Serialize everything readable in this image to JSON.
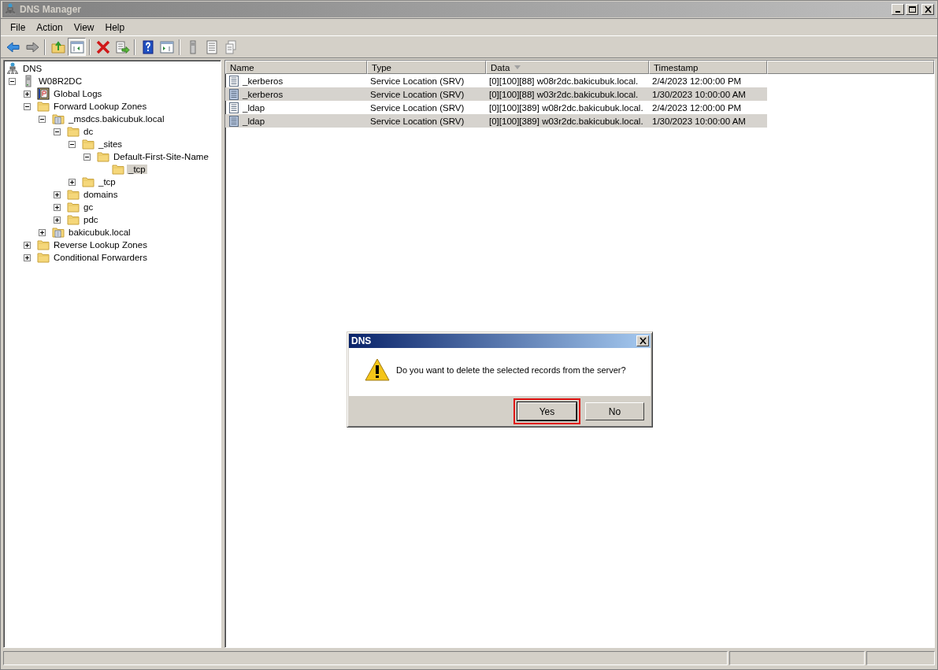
{
  "window": {
    "title": "DNS Manager"
  },
  "menu": [
    "File",
    "Action",
    "View",
    "Help"
  ],
  "toolbar": [
    {
      "buttons": [
        {
          "kind": "back",
          "pressed": false
        },
        {
          "kind": "forward",
          "pressed": false
        }
      ]
    },
    {
      "buttons": [
        {
          "kind": "up",
          "pressed": false
        },
        {
          "kind": "tree",
          "pressed": true
        }
      ]
    },
    {
      "buttons": [
        {
          "kind": "delete",
          "pressed": false
        },
        {
          "kind": "export",
          "pressed": false
        }
      ]
    },
    {
      "buttons": [
        {
          "kind": "help",
          "pressed": false
        },
        {
          "kind": "pane",
          "pressed": false
        }
      ]
    },
    {
      "buttons": [
        {
          "kind": "server",
          "pressed": false
        },
        {
          "kind": "list",
          "pressed": false
        },
        {
          "kind": "copy",
          "pressed": false
        }
      ]
    }
  ],
  "tree": [
    {
      "label": "DNS",
      "kind": "dns",
      "selected": false,
      "children": [
        {
          "label": "W08R2DC",
          "kind": "server",
          "expanded": true,
          "selected": false,
          "children": [
            {
              "label": "Global Logs",
              "kind": "logs",
              "expanded": false,
              "selected": false
            },
            {
              "label": "Forward Lookup Zones",
              "kind": "folder",
              "expanded": true,
              "selected": false,
              "children": [
                {
                  "label": "_msdcs.bakicubuk.local",
                  "kind": "zone",
                  "expanded": true,
                  "selected": false,
                  "children": [
                    {
                      "label": "dc",
                      "kind": "folder",
                      "expanded": true,
                      "selected": false,
                      "children": [
                        {
                          "label": "_sites",
                          "kind": "folder",
                          "expanded": true,
                          "selected": false,
                          "children": [
                            {
                              "label": "Default-First-Site-Name",
                              "kind": "folder",
                              "expanded": true,
                              "selected": false,
                              "children": [
                                {
                                  "label": "_tcp",
                                  "kind": "folder",
                                  "selected": true
                                }
                              ]
                            }
                          ]
                        },
                        {
                          "label": "_tcp",
                          "kind": "folder",
                          "expanded": false,
                          "selected": false
                        }
                      ]
                    },
                    {
                      "label": "domains",
                      "kind": "folder",
                      "expanded": false,
                      "selected": false
                    },
                    {
                      "label": "gc",
                      "kind": "folder",
                      "expanded": false,
                      "selected": false
                    },
                    {
                      "label": "pdc",
                      "kind": "folder",
                      "expanded": false,
                      "selected": false
                    }
                  ]
                },
                {
                  "label": "bakicubuk.local",
                  "kind": "zone",
                  "expanded": false,
                  "selected": false
                }
              ]
            },
            {
              "label": "Reverse Lookup Zones",
              "kind": "folder",
              "expanded": false,
              "selected": false
            },
            {
              "label": "Conditional Forwarders",
              "kind": "folder",
              "expanded": false,
              "selected": false
            }
          ]
        }
      ]
    }
  ],
  "list": {
    "columns": [
      {
        "label": "Name",
        "sorted": false
      },
      {
        "label": "Type",
        "sorted": false
      },
      {
        "label": "Data",
        "sorted": true
      },
      {
        "label": "Timestamp",
        "sorted": false
      }
    ],
    "rows": [
      {
        "name": "_kerberos",
        "type": "Service Location (SRV)",
        "data": "[0][100][88] w08r2dc.bakicubuk.local.",
        "timestamp": "2/4/2023 12:00:00 PM",
        "selected": false
      },
      {
        "name": "_kerberos",
        "type": "Service Location (SRV)",
        "data": "[0][100][88] w03r2dc.bakicubuk.local.",
        "timestamp": "1/30/2023 10:00:00 AM",
        "selected": true
      },
      {
        "name": "_ldap",
        "type": "Service Location (SRV)",
        "data": "[0][100][389] w08r2dc.bakicubuk.local.",
        "timestamp": "2/4/2023 12:00:00 PM",
        "selected": false
      },
      {
        "name": "_ldap",
        "type": "Service Location (SRV)",
        "data": "[0][100][389] w03r2dc.bakicubuk.local.",
        "timestamp": "1/30/2023 10:00:00 AM",
        "selected": true
      }
    ]
  },
  "dialog": {
    "title": "DNS",
    "message": "Do you want to delete the selected records from the server?",
    "buttons": [
      {
        "label": "Yes",
        "default": true,
        "highlighted": true
      },
      {
        "label": "No",
        "default": false,
        "highlighted": false
      }
    ]
  }
}
